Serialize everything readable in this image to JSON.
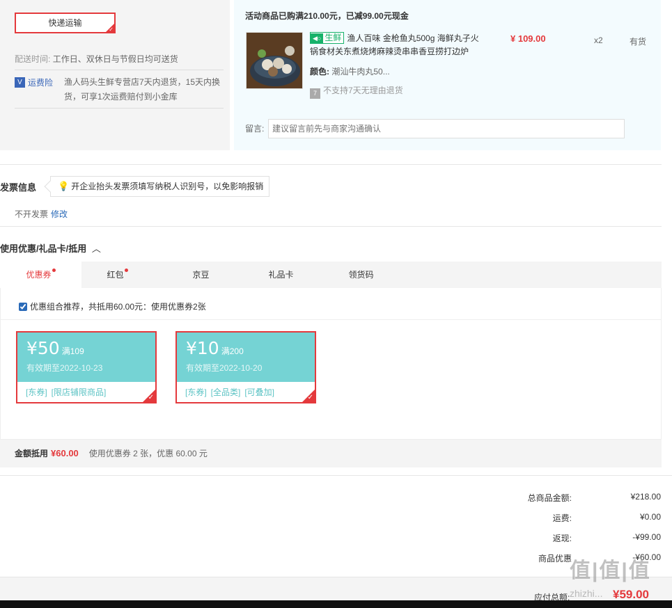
{
  "shipping": {
    "method_label": "快递运输",
    "time_label": "配送时间:",
    "time_value": "工作日、双休日与节假日均可送货",
    "insurance_badge": "V",
    "insurance_name": "运费险",
    "insurance_desc": "渔人码头生鲜专营店7天内退货，15天内换货，可享1次运费赔付到小金库"
  },
  "product": {
    "promo": "活动商品已购满210.00元，已减99.00元现金",
    "fresh_tag": "生鲜",
    "fresh_icon": "fish-icon",
    "title": "渔人百味 金枪鱼丸500g 海鲜丸子火锅食材关东煮烧烤麻辣烫串串香豆捞打边炉",
    "price": "¥ 109.00",
    "qty": "x2",
    "stock": "有货",
    "color_label": "颜色:",
    "color_value": "潮汕牛肉丸50...",
    "no_return_icon": "7",
    "no_return": "不支持7天无理由退货",
    "message_label": "留言:",
    "message_placeholder": "建议留言前先与商家沟通确认"
  },
  "invoice": {
    "title": "发票信息",
    "tip": "开企业抬头发票须填写纳税人识别号，以免影响报销",
    "value": "不开发票",
    "edit": "修改"
  },
  "coupons": {
    "title": "使用优惠/礼品卡/抵用",
    "tabs": [
      {
        "label": "优惠券",
        "dot": true
      },
      {
        "label": "红包",
        "dot": true
      },
      {
        "label": "京豆",
        "dot": false
      },
      {
        "label": "礼品卡",
        "dot": false
      },
      {
        "label": "领货码",
        "dot": false
      }
    ],
    "recommend_text": "优惠组合推荐，共抵用60.00元：使用优惠券2张",
    "items": [
      {
        "amount": "¥50",
        "condition": "满109",
        "expiry": "有效期至2022-10-23",
        "tags": [
          "[东券]",
          "[限店铺限商品]"
        ]
      },
      {
        "amount": "¥10",
        "condition": "满200",
        "expiry": "有效期至2022-10-20",
        "tags": [
          "[东券]",
          "[全品类]",
          "[可叠加]"
        ]
      }
    ],
    "summary_label": "金额抵用",
    "summary_amount": "¥60.00",
    "summary_desc": "使用优惠券 2 张，优惠 60.00 元"
  },
  "totals": {
    "rows": [
      {
        "label": "总商品金额:",
        "value": "¥218.00"
      },
      {
        "label": "运费:",
        "value": "¥0.00"
      },
      {
        "label": "返现:",
        "value": "-¥99.00"
      },
      {
        "label": "商品优惠",
        "value": "-¥60.00"
      }
    ],
    "payable_label": "应付总额:",
    "payable_value": "¥59.00"
  },
  "watermark": {
    "text": "值|值|值",
    "sub": "zhizhi..."
  }
}
